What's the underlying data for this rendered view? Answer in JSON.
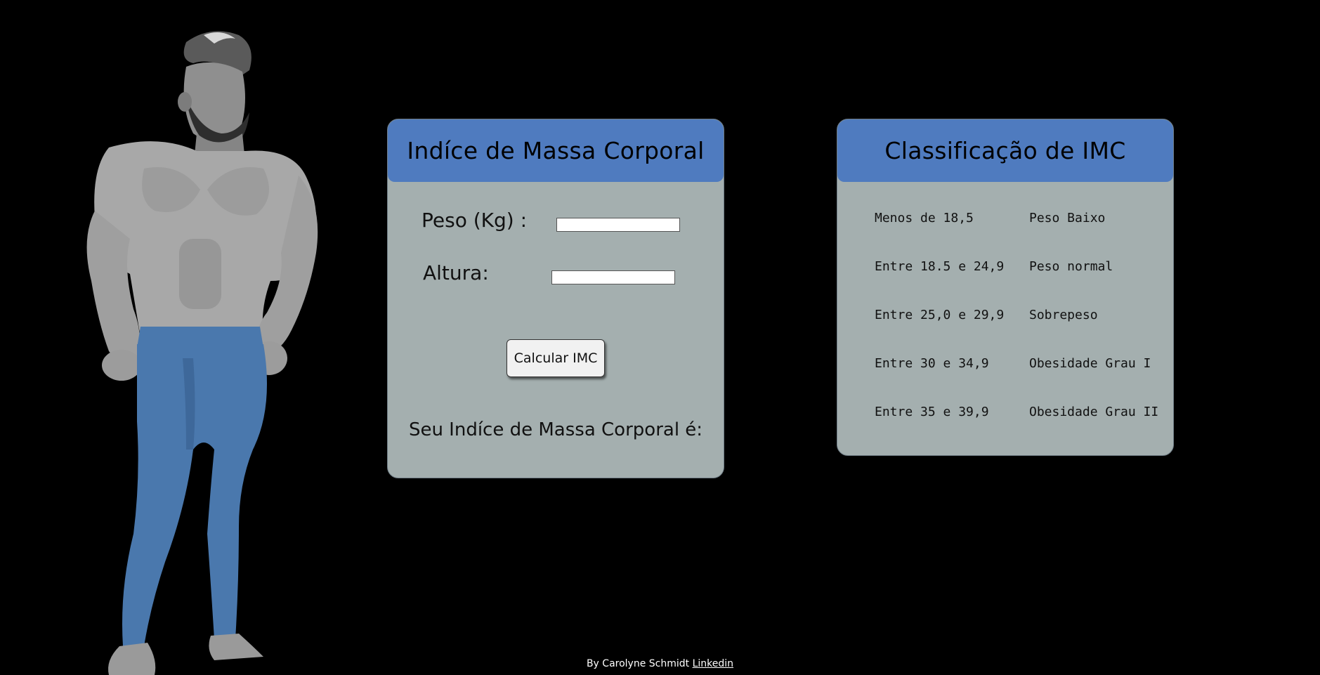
{
  "imc_card": {
    "title": "Indíce de Massa Corporal",
    "peso_label": "Peso (Kg) :",
    "peso_value": "",
    "altura_label": "Altura:",
    "altura_value": "",
    "button_label": "Calcular IMC",
    "result_label": "Seu Indíce de Massa Corporal é:"
  },
  "class_card": {
    "title": "Classificação de IMC",
    "rows": [
      {
        "range": "Menos de 18,5",
        "label": "Peso Baixo"
      },
      {
        "range": "Entre 18.5 e 24,9",
        "label": "Peso normal"
      },
      {
        "range": "Entre 25,0 e 29,9",
        "label": "Sobrepeso"
      },
      {
        "range": "Entre 30 e 34,9",
        "label": "Obesidade Grau I"
      },
      {
        "range": "Entre 35 e 39,9",
        "label": "Obesidade Grau II"
      }
    ]
  },
  "footer": {
    "text": "By Carolyne Schmidt",
    "link_label": "Linkedin"
  },
  "colors": {
    "background": "#000000",
    "card": "#a4afaf",
    "header": "#4f7bbf",
    "jeans": "#4a78ad",
    "skin": "#9a9a9a"
  },
  "illustration": "muscular-man-bodybuilder"
}
